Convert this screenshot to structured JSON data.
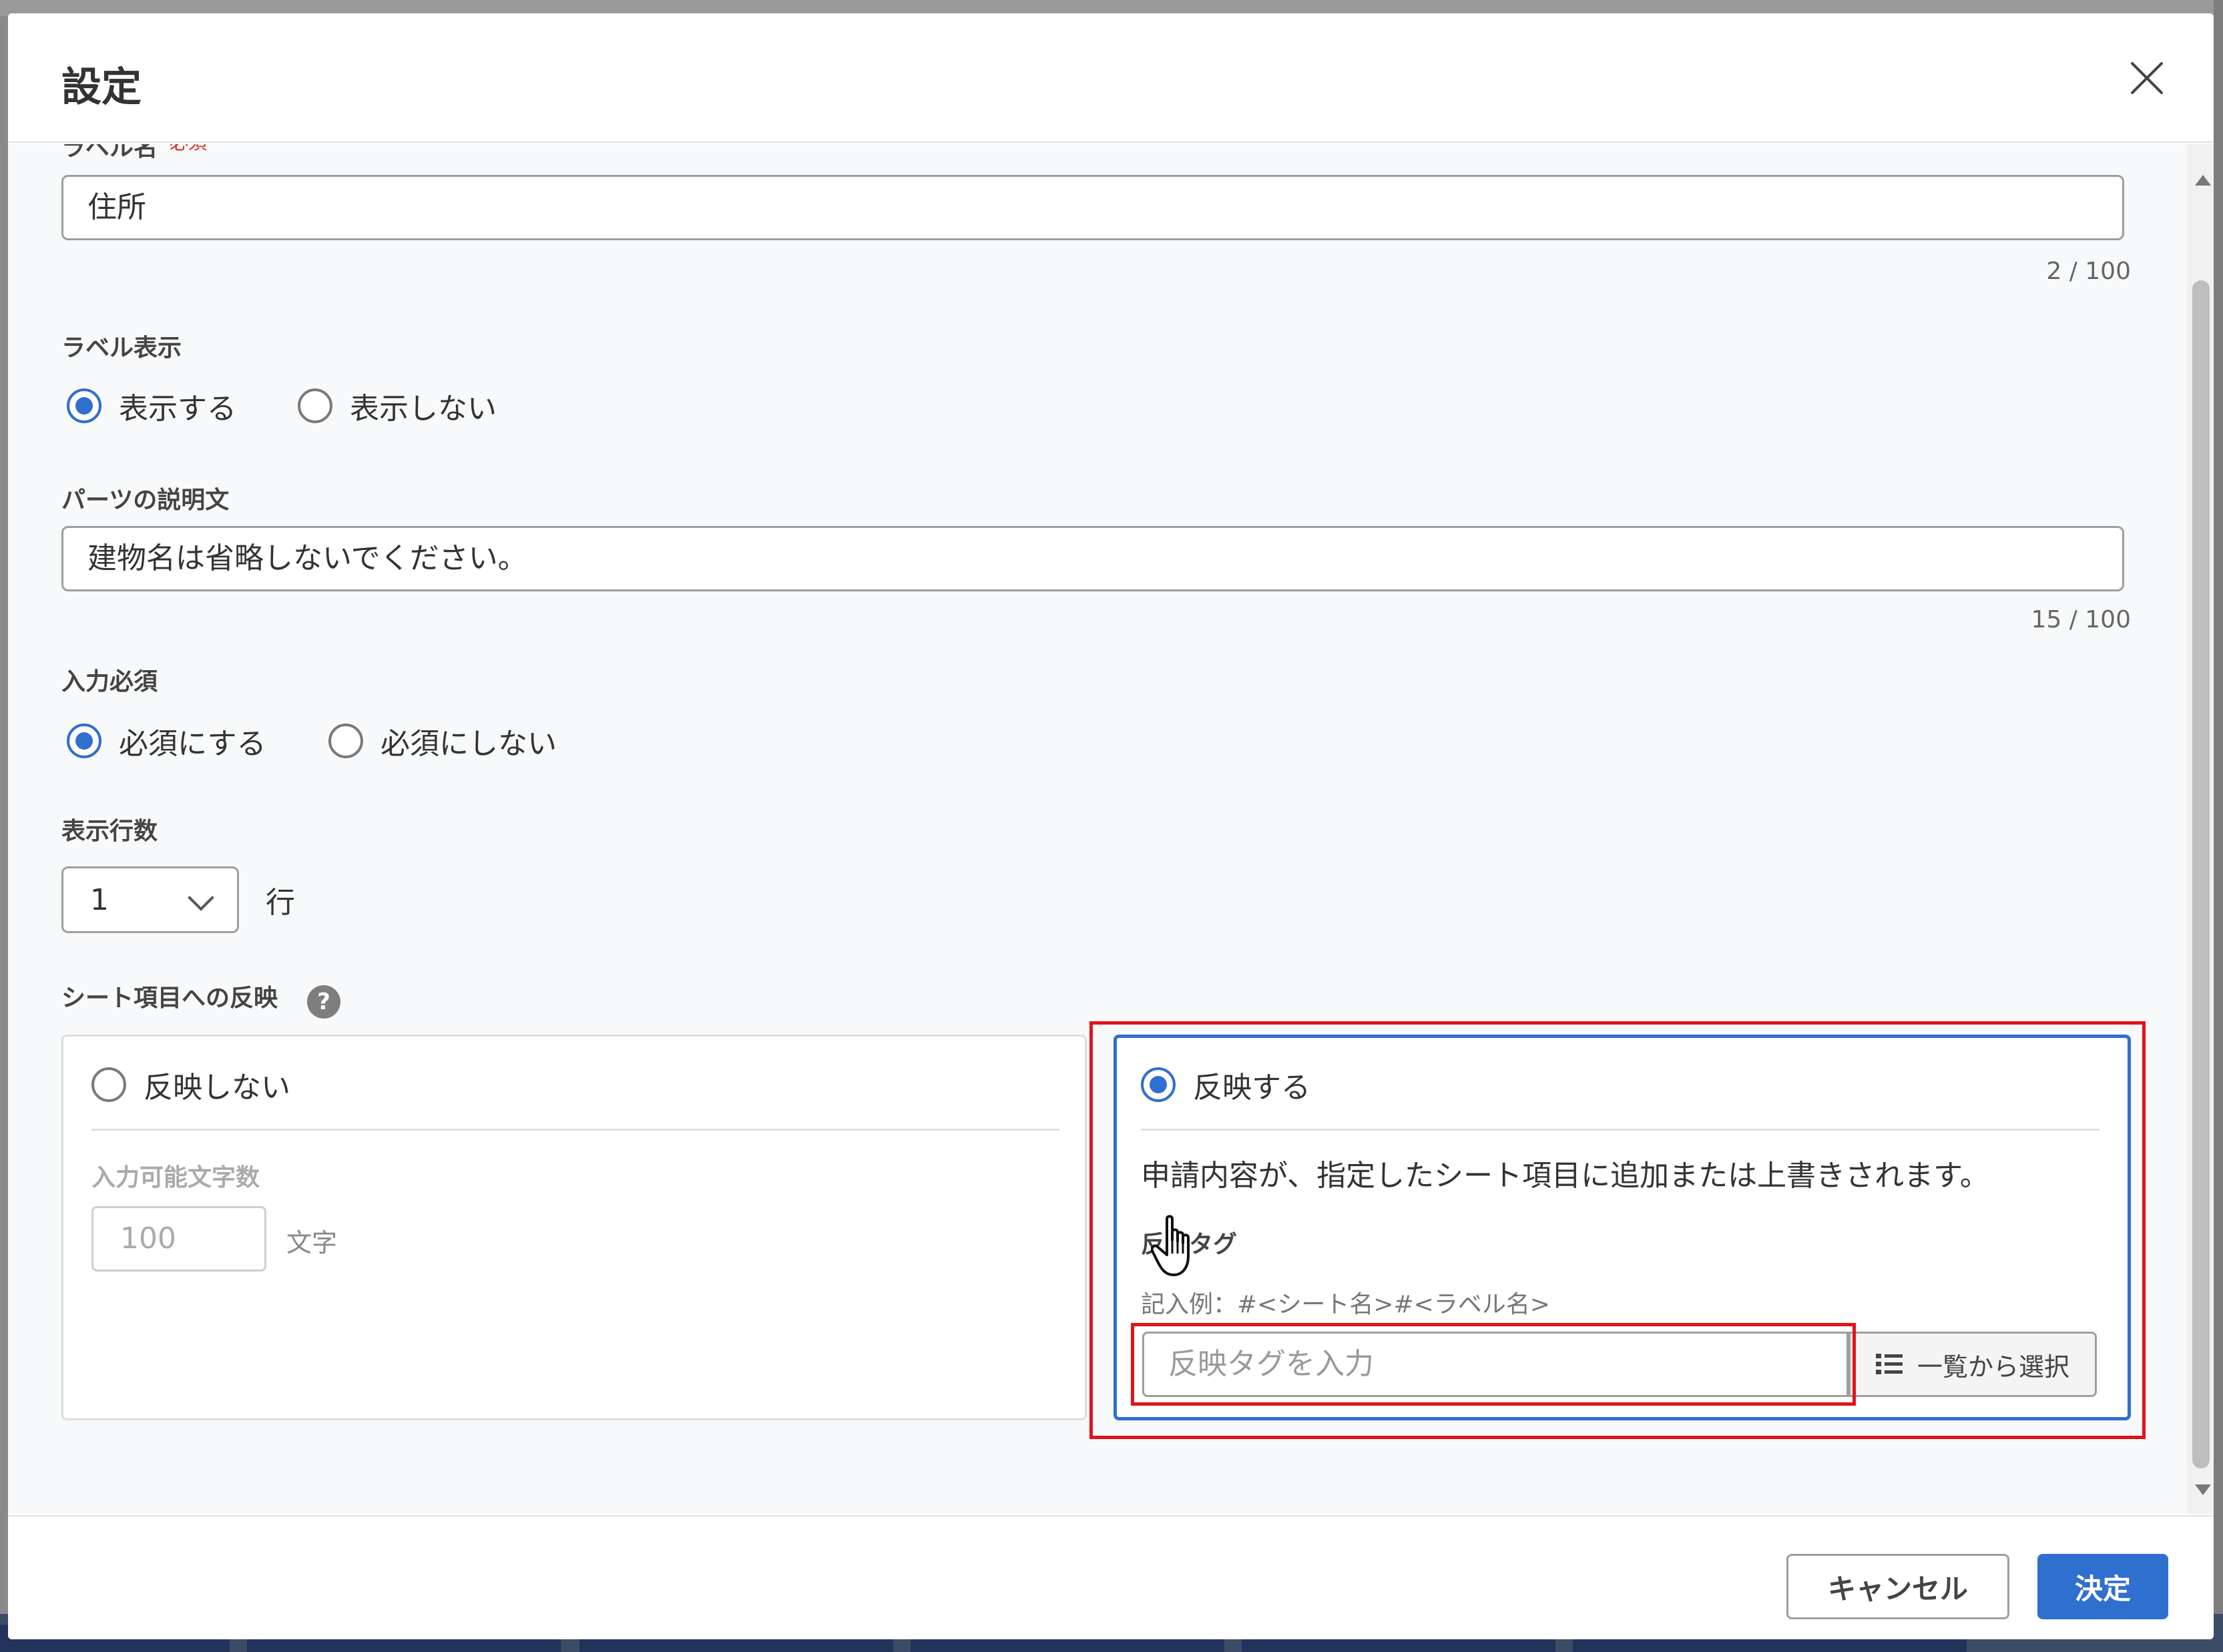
{
  "dialog": {
    "title": "設定",
    "close_label": "×"
  },
  "label_name": {
    "label": "ラベル名",
    "required_mark": "*必須",
    "value": "住所",
    "counter": "2 / 100"
  },
  "label_display": {
    "label": "ラベル表示",
    "options": [
      "表示する",
      "表示しない"
    ],
    "selected": "表示する"
  },
  "description": {
    "label": "パーツの説明文",
    "value": "建物名は省略しないでください。",
    "counter": "15 / 100"
  },
  "required": {
    "label": "入力必須",
    "options": [
      "必須にする",
      "必須にしない"
    ],
    "selected": "必須にする"
  },
  "rows": {
    "label": "表示行数",
    "value": "1",
    "unit": "行"
  },
  "sheet_reflect": {
    "label": "シート項目への反映",
    "help_icon": "question-circle-icon",
    "no_reflect": {
      "option": "反映しない",
      "char_limit_label": "入力可能文字数",
      "char_limit_value": "100",
      "char_unit": "文字"
    },
    "reflect": {
      "option": "反映する",
      "description": "申請内容が、指定したシート項目に追加または上書きされます。",
      "tag_label": "反映タグ",
      "example": "記入例：#<シート名>#<ラベル名>",
      "tag_placeholder": "反映タグを入力",
      "list_button": "一覧から選択",
      "list_icon": "list-icon"
    },
    "selected": "反映する"
  },
  "footer": {
    "cancel": "キャンセル",
    "ok": "決定"
  },
  "colors": {
    "accent": "#2f6fce",
    "highlight": "#e0141a"
  }
}
